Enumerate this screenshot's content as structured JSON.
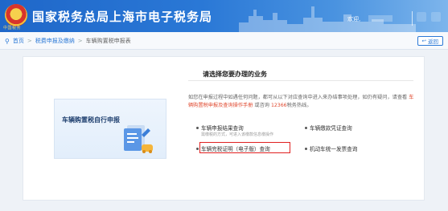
{
  "header": {
    "site_title": "国家税务总局上海市电子税务局",
    "emblem_caption": "中国税务",
    "welcome": "欢迎,"
  },
  "breadcrumb": {
    "home": "首页",
    "level1": "税费申报及缴纳",
    "level2": "车辆购置税申报表",
    "separator": ">",
    "back_label": "返回"
  },
  "panel": {
    "title": "请选择您要办理的业务",
    "info_text": "如您在申报过程中如遇任何问题，都可从以下对应查询中进入来办结事项处理，如仍有疑问，请查看",
    "info_link": "车辆购置税申报及查询操作手册",
    "info_mid": "或咨询",
    "info_hotline": "12366",
    "info_tail": "税务热线。"
  },
  "tile": {
    "label": "车辆购置税自行申报"
  },
  "options": [
    {
      "label": "车辆申报结果查询",
      "sub": "需缴税的方式，可进入该缴款信息缴操作"
    },
    {
      "label": "车辆缴款凭证查询",
      "sub": ""
    },
    {
      "label": "车辆完税证明（电子版）查询",
      "sub": ""
    },
    {
      "label": "机动车统一发票查询",
      "sub": ""
    }
  ],
  "icons": {
    "location": "location-pin-icon",
    "back": "return-arrow-icon",
    "tile_art": "tax-form-document-icon"
  },
  "colors": {
    "header_blue": "#2a78d6",
    "highlight_red": "#e02020",
    "link_red": "#e0492f"
  }
}
